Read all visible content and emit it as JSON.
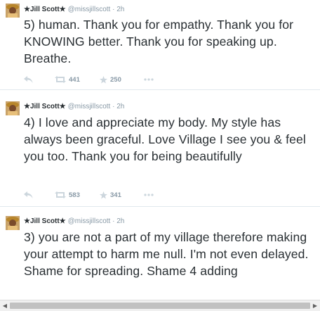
{
  "tweets": [
    {
      "name": "Jill Scott",
      "handle": "@missjillscott",
      "sep": "·",
      "time": "2h",
      "text": "5) human. Thank you for empathy. Thank you for KNOWING better. Thank you for speaking up. Breathe.",
      "retweets": "441",
      "favorites": "250"
    },
    {
      "name": "Jill Scott",
      "handle": "@missjillscott",
      "sep": "·",
      "time": "2h",
      "text": "4) I love and appreciate my body. My style has always been graceful. Love Village I see you & feel you too. Thank you for being beautifully",
      "retweets": "583",
      "favorites": "341"
    },
    {
      "name": "Jill Scott",
      "handle": "@missjillscott",
      "sep": "·",
      "time": "2h",
      "text": "3) you are not a part of my village therefore making your attempt to harm me null. I'm not even delayed. Shame for spreading. Shame 4 adding"
    }
  ],
  "name_star": "★",
  "icons": {
    "reply": "reply-icon",
    "retweet": "retweet-icon",
    "favorite": "star-icon",
    "more": "more-icon"
  },
  "colors": {
    "text": "#292f33",
    "meta": "#8899a6",
    "divider": "#e1e8ed"
  }
}
